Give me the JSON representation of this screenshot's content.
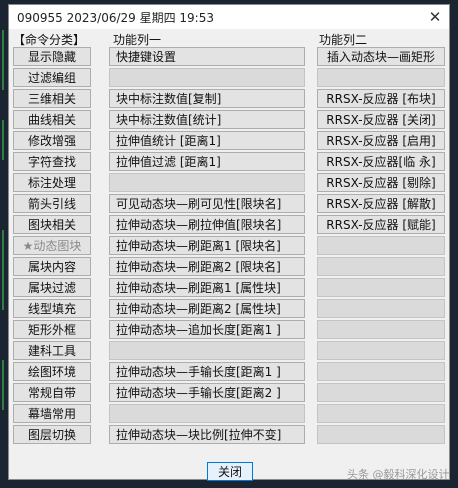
{
  "window": {
    "title": "090955 2023/06/29 星期四 19:53",
    "close_glyph": "✕"
  },
  "columns": {
    "categories_header": "【命令分类】",
    "col1_header": "功能列一",
    "col2_header": "功能列二"
  },
  "categories": [
    "显示隐藏",
    "过滤编组",
    "三维相关",
    "曲线相关",
    "修改增强",
    "字符查找",
    "标注处理",
    "箭头引线",
    "图块相关",
    "★动态图块",
    "属块内容",
    "属块过滤",
    "线型填充",
    "矩形外框",
    "建科工具",
    "绘图环境",
    "常规自带",
    "幕墙常用",
    "图层切换"
  ],
  "col1": [
    "快捷键设置",
    "",
    "块中标注数值[复制]",
    "块中标注数值[统计]",
    "拉伸值统计 [距离1]",
    "拉伸值过滤 [距离1]",
    "",
    "可见动态块—刷可见性[限块名]",
    "拉伸动态块—刷拉伸值[限块名]",
    "拉伸动态块—刷距离1 [限块名]",
    "拉伸动态块—刷距离2 [限块名]",
    "拉伸动态块—刷距离1 [属性块]",
    "拉伸动态块—刷距离2 [属性块]",
    "拉伸动态块—追加长度[距离1 ]",
    "",
    "拉伸动态块—手输长度[距离1 ]",
    "拉伸动态块—手输长度[距离2 ]",
    "",
    "拉伸动态块—块比例[拉伸不变]"
  ],
  "col2": [
    "插入动态块—画矩形",
    "",
    "RRSX-反应器 [布块]",
    "RRSX-反应器 [关闭]",
    "RRSX-反应器 [启用]",
    "RRSX-反应器[临 永]",
    "RRSX-反应器 [剔除]",
    "RRSX-反应器 [解散]",
    "RRSX-反应器 [赋能]",
    "",
    "",
    "",
    "",
    "",
    "",
    "",
    "",
    "",
    ""
  ],
  "footer": {
    "close_label": "关闭",
    "watermark": "头条 @毅科深化设计"
  }
}
